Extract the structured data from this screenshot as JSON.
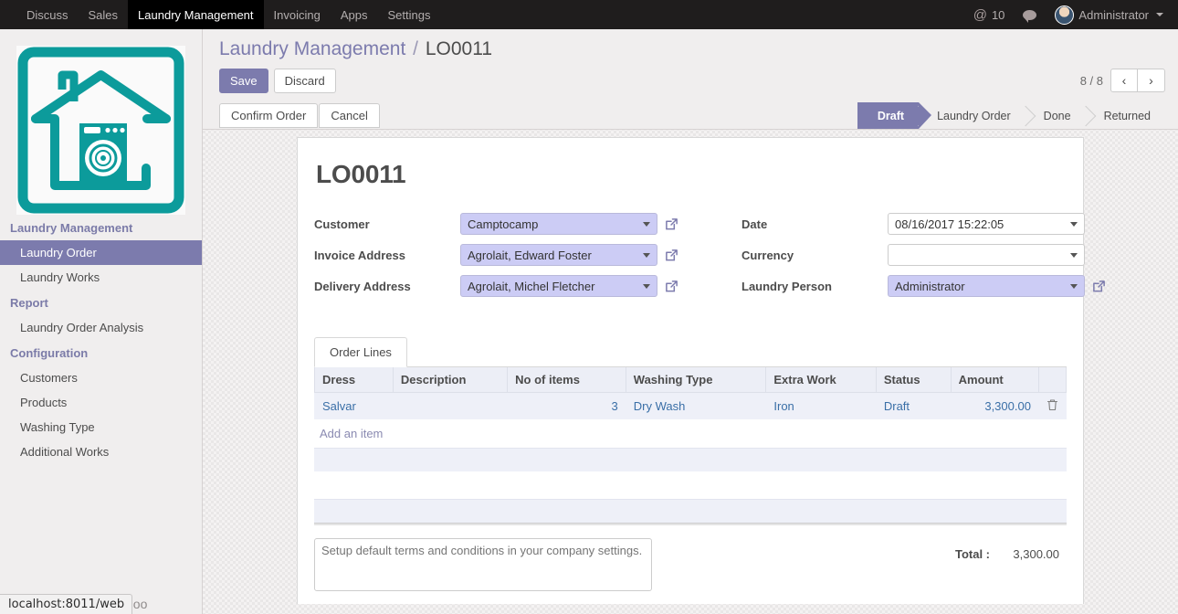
{
  "navbar": {
    "menus": [
      {
        "label": "Discuss",
        "active": false
      },
      {
        "label": "Sales",
        "active": false
      },
      {
        "label": "Laundry Management",
        "active": true
      },
      {
        "label": "Invoicing",
        "active": false
      },
      {
        "label": "Apps",
        "active": false
      },
      {
        "label": "Settings",
        "active": false
      }
    ],
    "mention_icon": "at-icon",
    "mention_count": "10",
    "chat_icon": "chat-bubble-icon",
    "user_name": "Administrator"
  },
  "sidebar": {
    "logo_icon": "laundry-house-logo",
    "sections": [
      {
        "title": "Laundry Management",
        "items": [
          {
            "label": "Laundry Order",
            "active": true
          },
          {
            "label": "Laundry Works",
            "active": false
          }
        ]
      },
      {
        "title": "Report",
        "items": [
          {
            "label": "Laundry Order Analysis",
            "active": false
          }
        ]
      },
      {
        "title": "Configuration",
        "items": [
          {
            "label": "Customers",
            "active": false
          },
          {
            "label": "Products",
            "active": false
          },
          {
            "label": "Washing Type",
            "active": false
          },
          {
            "label": "Additional Works",
            "active": false
          }
        ]
      }
    ]
  },
  "control_panel": {
    "breadcrumb_root": "Laundry Management",
    "breadcrumb_sep": "/",
    "breadcrumb_current": "LO0011",
    "save_label": "Save",
    "discard_label": "Discard",
    "pager_count": "8 / 8",
    "prev_icon": "chevron-left-icon",
    "next_icon": "chevron-right-icon",
    "confirm_label": "Confirm Order",
    "cancel_label": "Cancel",
    "stages": [
      {
        "label": "Draft",
        "active": true
      },
      {
        "label": "Laundry Order",
        "active": false
      },
      {
        "label": "Done",
        "active": false
      },
      {
        "label": "Returned",
        "active": false
      }
    ]
  },
  "form": {
    "record_title": "LO0011",
    "left_fields": [
      {
        "label": "Customer",
        "value": "Camptocamp",
        "highlight": true,
        "external": true
      },
      {
        "label": "Invoice Address",
        "value": "Agrolait, Edward Foster",
        "highlight": true,
        "external": true
      },
      {
        "label": "Delivery Address",
        "value": "Agrolait, Michel Fletcher",
        "highlight": true,
        "external": true
      }
    ],
    "right_fields": [
      {
        "label": "Date",
        "value": "08/16/2017 15:22:05",
        "highlight": false,
        "external": false
      },
      {
        "label": "Currency",
        "value": "",
        "highlight": false,
        "external": false
      },
      {
        "label": "Laundry Person",
        "value": "Administrator",
        "highlight": true,
        "external": true
      }
    ],
    "tab_label": "Order Lines",
    "table": {
      "columns": [
        "Dress",
        "Description",
        "No of items",
        "Washing Type",
        "Extra Work",
        "Status",
        "Amount"
      ],
      "rows": [
        {
          "dress": "Salvar",
          "description": "",
          "no_of_items": "3",
          "washing_type": "Dry Wash",
          "extra_work": "Iron",
          "status": "Draft",
          "amount": "3,300.00",
          "delete_icon": "trash-icon"
        }
      ],
      "add_item_label": "Add an item"
    },
    "terms_placeholder": "Setup default terms and conditions in your company settings.",
    "terms_value": "",
    "total_label": "Total :",
    "total_value": "3,300.00"
  },
  "browser": {
    "status_url": "localhost:8011/web",
    "brand_text": "doo"
  }
}
